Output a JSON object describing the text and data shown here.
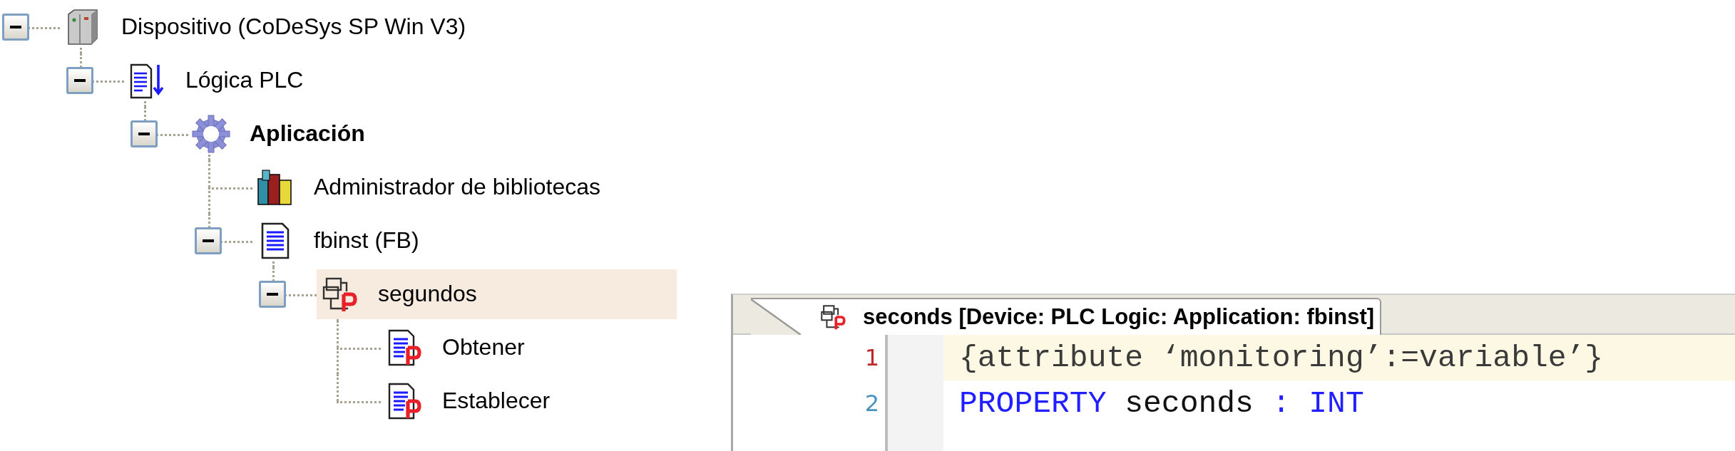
{
  "tree": [
    {
      "label": "Dispositivo (CoDeSys SP Win V3)",
      "kind": "device",
      "bold": false,
      "selected": false,
      "expanded": true,
      "children": [
        {
          "label": "Lógica PLC",
          "kind": "plc-logic",
          "bold": false,
          "selected": false,
          "expanded": true,
          "children": [
            {
              "label": "Aplicación",
              "kind": "application",
              "bold": true,
              "selected": false,
              "expanded": true,
              "children": [
                {
                  "label": "Administrador de bibliotecas",
                  "kind": "library",
                  "bold": false,
                  "selected": false
                },
                {
                  "label": "fbinst (FB)",
                  "kind": "pou",
                  "bold": false,
                  "selected": false,
                  "expanded": true,
                  "children": [
                    {
                      "label": "segundos",
                      "kind": "property",
                      "bold": false,
                      "selected": true,
                      "expanded": true,
                      "children": [
                        {
                          "label": "Obtener",
                          "kind": "accessor",
                          "bold": false,
                          "selected": false
                        },
                        {
                          "label": "Establecer",
                          "kind": "accessor",
                          "bold": false,
                          "selected": false
                        }
                      ]
                    }
                  ]
                }
              ]
            }
          ]
        }
      ]
    }
  ],
  "editor": {
    "tab": {
      "title": "seconds [Device: PLC Logic: Application: fbinst]",
      "selected": true
    },
    "lines": [
      {
        "number": "1",
        "current": true,
        "tokens": [
          {
            "kind": "pragma",
            "text": "{attribute ‘monitoring’:=variable’}"
          }
        ]
      },
      {
        "number": "2",
        "current": false,
        "tokens": [
          {
            "kind": "keyword",
            "text": "PROPERTY"
          },
          {
            "kind": "plain",
            "text": " seconds "
          },
          {
            "kind": "operator",
            "text": ":"
          },
          {
            "kind": "keyword",
            "text": " INT"
          }
        ]
      }
    ]
  }
}
